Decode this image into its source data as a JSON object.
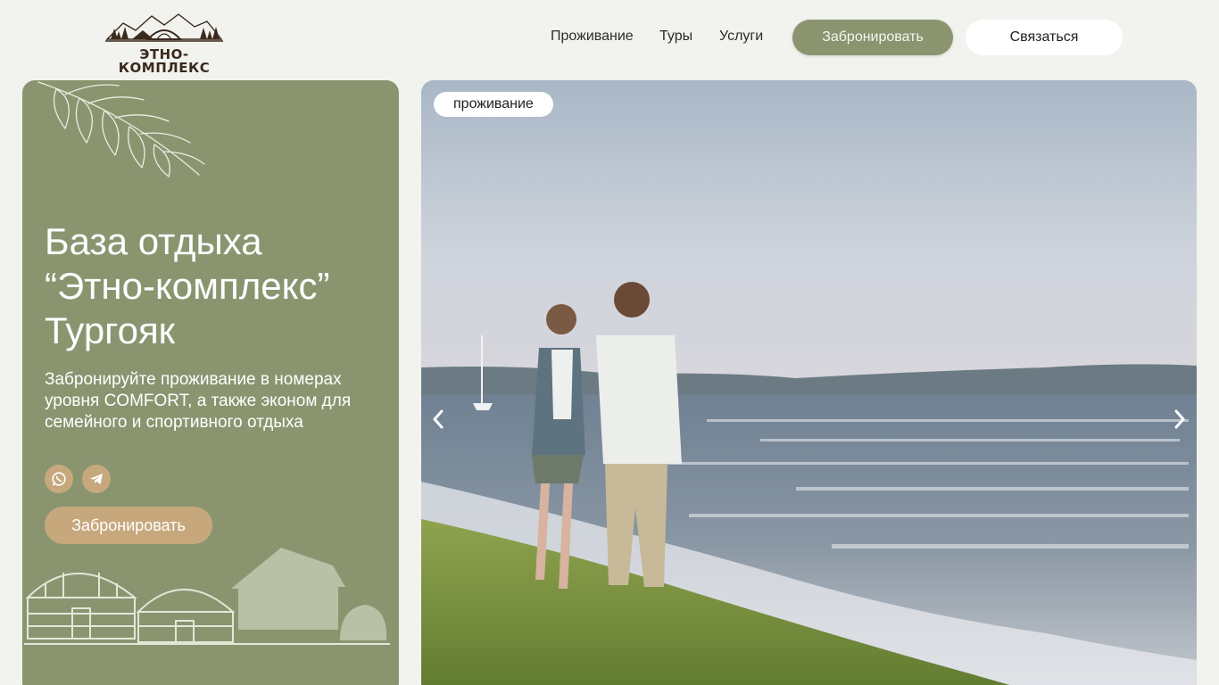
{
  "header": {
    "logo_text": "ЭТНО-КОМПЛЕКС",
    "nav": [
      {
        "label": "Проживание"
      },
      {
        "label": "Туры"
      },
      {
        "label": "Услуги"
      }
    ],
    "book_label": "Забронировать",
    "contact_label": "Связаться"
  },
  "promo": {
    "title_lines": [
      "База отдыха",
      "“Этно-комплекс”",
      "Тургояк"
    ],
    "description": "Забронируйте проживание в номерах уровня COMFORT, а также эконом для семейного и спортивного отдыха",
    "social": [
      {
        "icon": "whatsapp-icon"
      },
      {
        "icon": "telegram-icon"
      }
    ],
    "book_label": "Забронировать"
  },
  "slider": {
    "tag": "проживание",
    "prev_icon": "chevron-left-icon",
    "next_icon": "chevron-right-icon"
  },
  "colors": {
    "page_bg": "#f2f2ee",
    "accent_green": "#8a9570",
    "accent_tan": "#c7a87d",
    "white": "#ffffff"
  }
}
